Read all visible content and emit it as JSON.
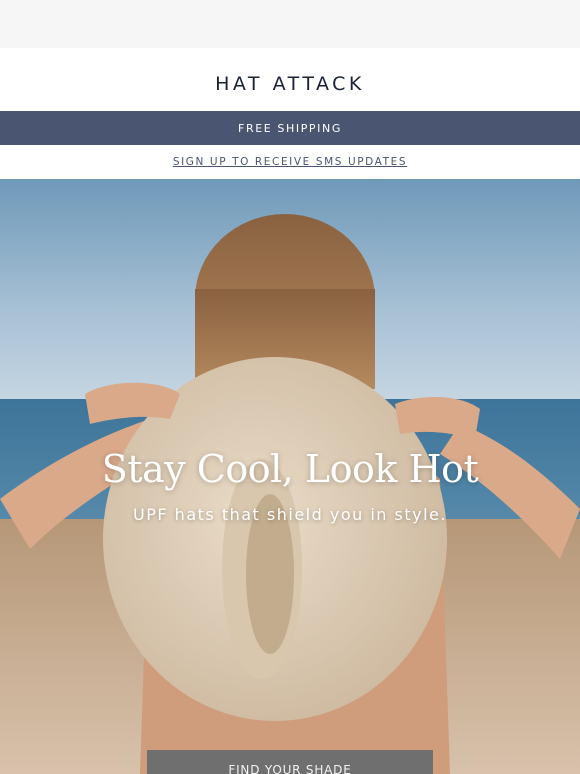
{
  "header": {
    "brand": "HAT ATTACK"
  },
  "banner": {
    "shipping": "FREE SHIPPING"
  },
  "sms": {
    "link": "SIGN UP TO RECEIVE SMS UPDATES"
  },
  "hero": {
    "title": "Stay Cool, Look Hot",
    "subtitle": "UPF hats that shield you in style.",
    "cta": "FIND YOUR SHADE"
  },
  "colors": {
    "accent": "#495571",
    "brand_text": "#1c2236",
    "cta_bg": "#6f6f6f"
  }
}
